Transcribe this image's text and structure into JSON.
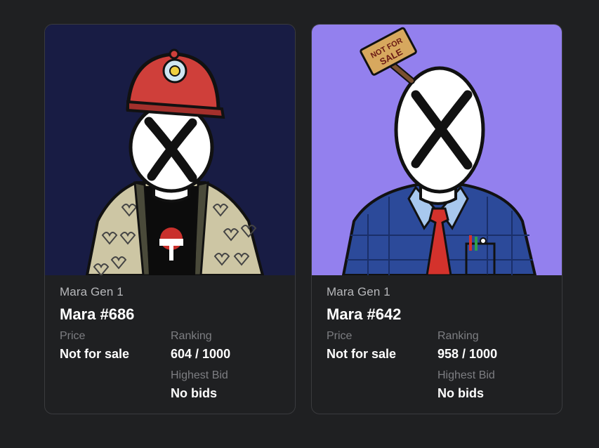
{
  "cards": [
    {
      "collection": "Mara Gen 1",
      "name": "Mara #686",
      "price_label": "Price",
      "price_value": "Not for sale",
      "ranking_label": "Ranking",
      "ranking_value": "604 / 1000",
      "bid_label": "Highest Bid",
      "bid_value": "No bids",
      "bg_color": "#181c44"
    },
    {
      "collection": "Mara Gen 1",
      "name": "Mara #642",
      "price_label": "Price",
      "price_value": "Not for sale",
      "ranking_label": "Ranking",
      "ranking_value": "958 / 1000",
      "bid_label": "Highest Bid",
      "bid_value": "No bids",
      "sign_text": "NOT FOR SALE",
      "bg_color": "#9380ee"
    }
  ]
}
